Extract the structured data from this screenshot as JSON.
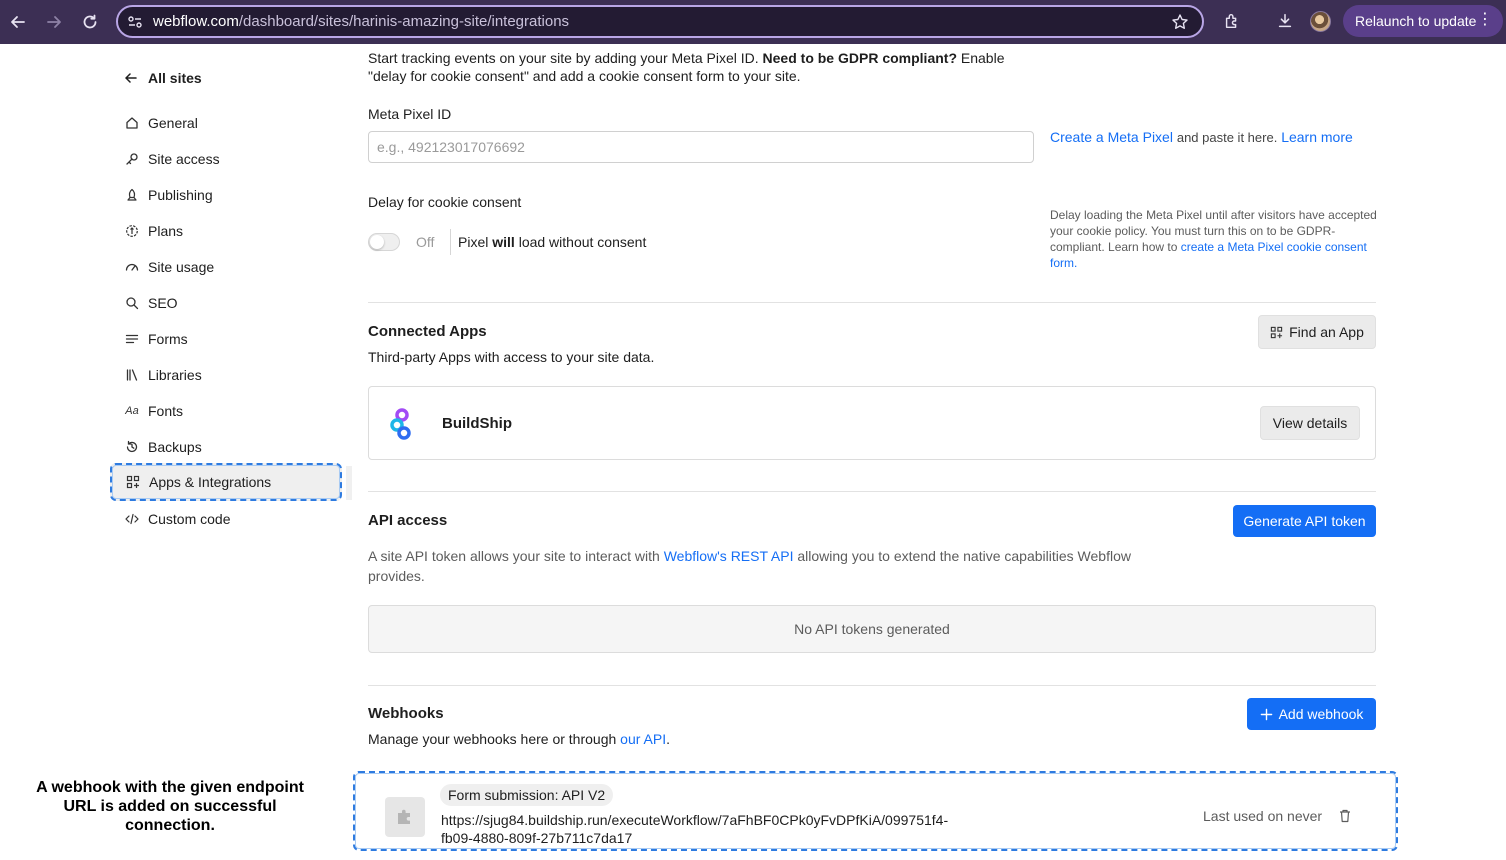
{
  "browser": {
    "url_host": "webflow.com",
    "url_path": "/dashboard/sites/harinis-amazing-site/integrations",
    "relaunch_label": "Relaunch to update"
  },
  "sidebar": {
    "back_label": "All sites",
    "items": [
      {
        "label": "General",
        "icon": "home-icon"
      },
      {
        "label": "Site access",
        "icon": "key-icon"
      },
      {
        "label": "Publishing",
        "icon": "rocket-icon"
      },
      {
        "label": "Plans",
        "icon": "plans-icon"
      },
      {
        "label": "Site usage",
        "icon": "gauge-icon"
      },
      {
        "label": "SEO",
        "icon": "search-icon"
      },
      {
        "label": "Forms",
        "icon": "forms-icon"
      },
      {
        "label": "Libraries",
        "icon": "libraries-icon"
      },
      {
        "label": "Fonts",
        "icon": "fonts-icon"
      },
      {
        "label": "Backups",
        "icon": "backup-icon"
      },
      {
        "label": "Apps & Integrations",
        "icon": "apps-icon",
        "active": true
      },
      {
        "label": "Custom code",
        "icon": "code-icon"
      }
    ]
  },
  "meta_pixel": {
    "intro_text": "Start tracking events on your site by adding your Meta Pixel ID.",
    "intro_bold": "Need to be GDPR compliant?",
    "intro_rest": "Enable \"delay for cookie consent\" and add a cookie consent form to your site.",
    "id_label": "Meta Pixel ID",
    "id_placeholder": "e.g., 492123017076692",
    "id_value": "",
    "help_link1": "Create a Meta Pixel",
    "help_mid": "and paste it here.",
    "help_link2": "Learn more",
    "delay_label": "Delay for cookie consent",
    "toggle_state": "Off",
    "toggle_desc_pre": "Pixel",
    "toggle_desc_bold": "will",
    "toggle_desc_post": "load without consent",
    "delay_help_text": "Delay loading the Meta Pixel until after visitors have accepted your cookie policy. You must turn this on to be GDPR-compliant. Learn how to",
    "delay_help_link": "create a Meta Pixel cookie consent form",
    "delay_help_end": "."
  },
  "connected_apps": {
    "title": "Connected Apps",
    "subtitle": "Third-party Apps with access to your site data.",
    "find_button": "Find an App",
    "apps": [
      {
        "name": "BuildShip",
        "button": "View details"
      }
    ]
  },
  "api_access": {
    "title": "API access",
    "button": "Generate API token",
    "desc_pre": "A site API token allows your site to interact with",
    "desc_link": "Webflow's REST API",
    "desc_post": "allowing you to extend the native capabilities Webflow provides.",
    "empty_text": "No API tokens generated"
  },
  "webhooks": {
    "title": "Webhooks",
    "button": "Add webhook",
    "desc_pre": "Manage your webhooks here or through",
    "desc_link": "our API",
    "desc_end": ".",
    "items": [
      {
        "trigger": "Form submission: API V2",
        "url": "https://sjug84.buildship.run/executeWorkflow/7aFhBF0CPk0yFvDPfKiA/099751f4-fb09-4880-809f-27b711c7da17",
        "last_used": "Last used on never"
      }
    ]
  },
  "annotation": "A webhook with the given endpoint URL is added on successful connection.",
  "colors": {
    "accent": "#146ef5",
    "chrome": "#3c2f54",
    "highlight": "#2e7be0"
  }
}
